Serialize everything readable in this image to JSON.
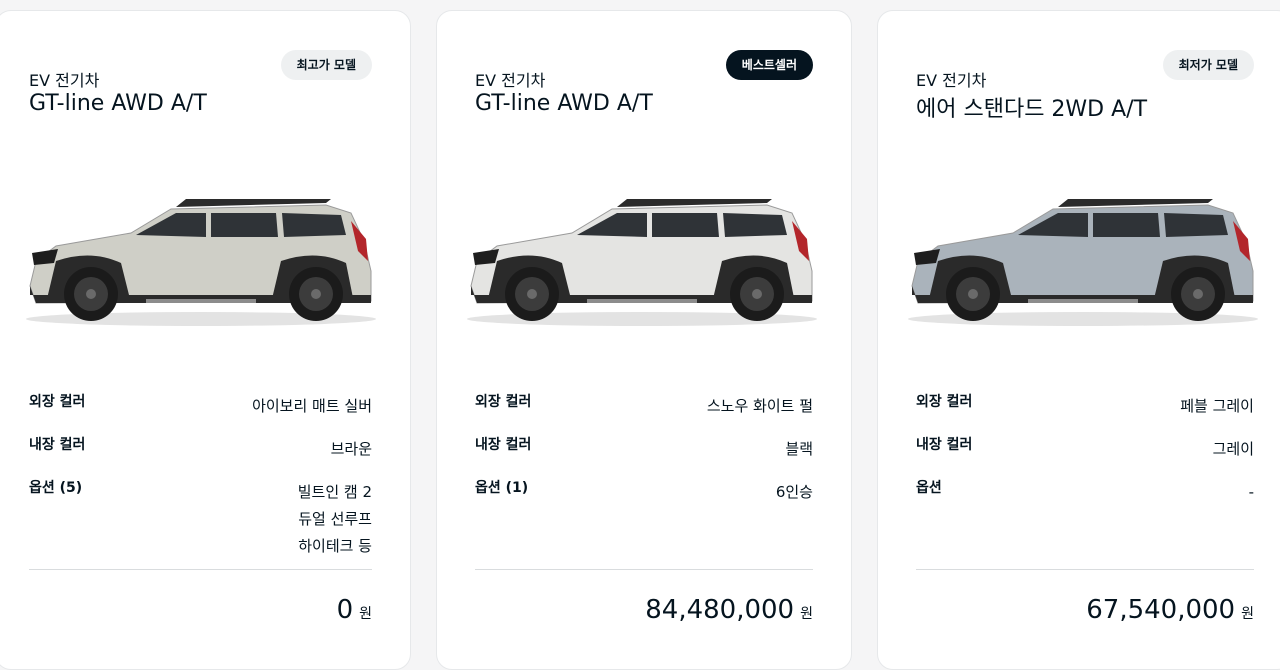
{
  "cards": [
    {
      "category": "EV 전기차",
      "model": "GT-line AWD A/T",
      "badge": "최고가 모델",
      "exterior_label": "외장 컬러",
      "exterior_value": "아이보리 매트 실버",
      "interior_label": "내장 컬러",
      "interior_value": "브라운",
      "options_label": "옵션 (5)",
      "options": [
        "빌트인 캠 2",
        "듀얼 선루프",
        "하이테크 등"
      ],
      "price": "0",
      "currency": "원",
      "body_color": "#cfcfc7"
    },
    {
      "category": "EV 전기차",
      "model": "GT-line AWD A/T",
      "badge": "베스트셀러",
      "exterior_label": "외장 컬러",
      "exterior_value": "스노우 화이트 펄",
      "interior_label": "내장 컬러",
      "interior_value": "블랙",
      "options_label": "옵션 (1)",
      "options": [
        "6인승"
      ],
      "price": "84,480,000",
      "currency": "원",
      "body_color": "#e4e4e2"
    },
    {
      "category": "EV 전기차",
      "model": "에어 스탠다드 2WD A/T",
      "badge": "최저가 모델",
      "exterior_label": "외장 컬러",
      "exterior_value": "페블 그레이",
      "interior_label": "내장 컬러",
      "interior_value": "그레이",
      "options_label": "옵션",
      "options": [
        "-"
      ],
      "price": "67,540,000",
      "currency": "원",
      "body_color": "#aab3bb"
    }
  ]
}
